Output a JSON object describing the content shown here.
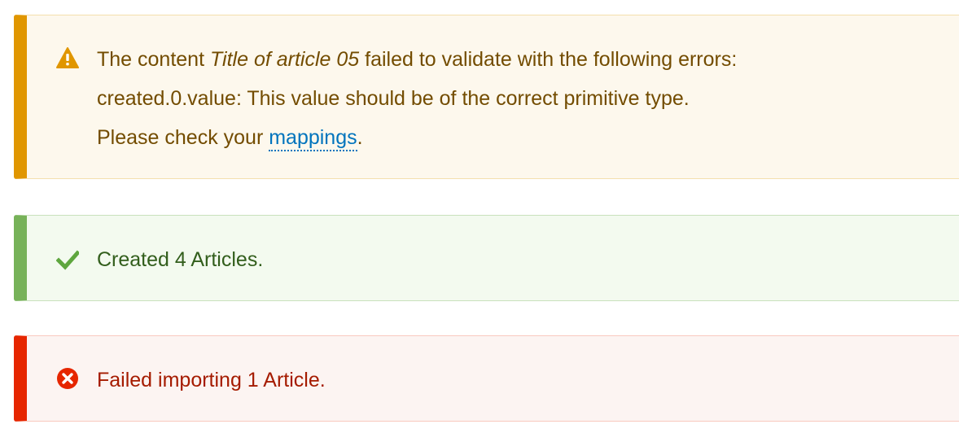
{
  "messages": {
    "warning": {
      "icon": "warning-icon",
      "prefix": "The content ",
      "content_title": "Title of article 05",
      "suffix": " failed to validate with the following errors:",
      "error_detail": "created.0.value: This value should be of the correct primitive type.",
      "check_prefix": "Please check your ",
      "link_label": "mappings",
      "check_suffix": "."
    },
    "status": {
      "icon": "checkmark-icon",
      "text": "Created 4 Articles."
    },
    "error": {
      "icon": "error-circle-icon",
      "text": "Failed importing 1 Article."
    }
  },
  "colors": {
    "warning_accent": "#e09600",
    "status_accent": "#77b259",
    "error_accent": "#e62600",
    "link": "#0074bd"
  }
}
